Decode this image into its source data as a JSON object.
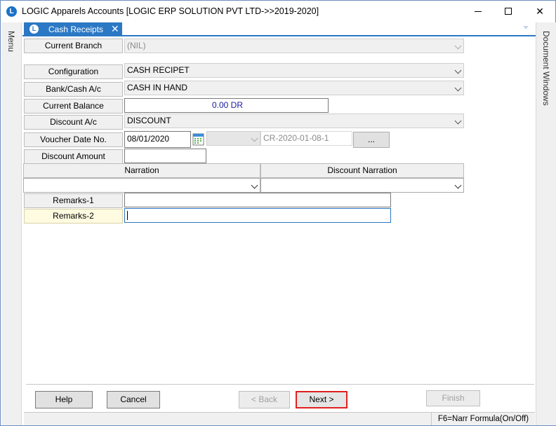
{
  "window": {
    "title": "LOGIC Apparels Accounts  [LOGIC ERP SOLUTION PVT LTD->>2019-2020]",
    "app_icon_letter": "L",
    "minimize": "",
    "maximize": "",
    "close": "✕"
  },
  "sidebar_left": {
    "label": "Menu"
  },
  "sidebar_right": {
    "label": "Document Windows"
  },
  "tab": {
    "label": "Cash Receipts",
    "icon_letter": "L",
    "close": "✕"
  },
  "form": {
    "current_branch": {
      "label": "Current Branch",
      "value": "(NIL)"
    },
    "configuration": {
      "label": "Configuration",
      "value": "CASH RECIPET"
    },
    "bank_cash": {
      "label": "Bank/Cash A/c",
      "value": "CASH IN HAND"
    },
    "current_balance": {
      "label": "Current Balance",
      "value": "0.00 DR"
    },
    "discount_ac": {
      "label": "Discount A/c",
      "value": "DISCOUNT"
    },
    "voucher": {
      "label": "Voucher Date  No.",
      "date": "08/01/2020",
      "series": "",
      "number": "CR-2020-01-08-1",
      "browse": "..."
    },
    "discount_amount": {
      "label": "Discount Amount",
      "value": ""
    },
    "narration": {
      "header": "Narration",
      "value": ""
    },
    "discount_narration": {
      "header": "Discount Narration",
      "value": ""
    },
    "remarks1": {
      "label": "Remarks-1",
      "value": ""
    },
    "remarks2": {
      "label": "Remarks-2",
      "value": ""
    }
  },
  "buttons": {
    "help": "Help",
    "cancel": "Cancel",
    "back": "< Back",
    "next": "Next >",
    "finish": "Finish"
  },
  "status": {
    "hint": "F6=Narr Formula(On/Off)"
  },
  "colors": {
    "accent": "#2b78c5",
    "highlight_border": "#e02020",
    "balance_text": "#1a1aa0"
  }
}
